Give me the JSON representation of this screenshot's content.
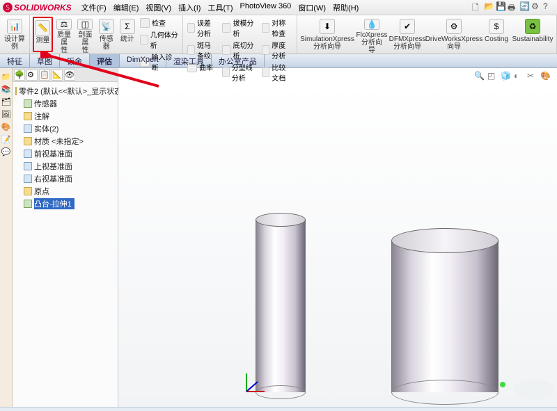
{
  "app": {
    "name": "SOLIDWORKS"
  },
  "menu": {
    "file": "文件(F)",
    "edit": "编辑(E)",
    "view": "视图(V)",
    "insert": "插入(I)",
    "tools": "工具(T)",
    "photoview": "PhotoView 360",
    "window": "窗口(W)",
    "help": "帮助(H)"
  },
  "ribbon": {
    "design_study": "设计算\n例",
    "measure": "测量",
    "mass_props": "质量属\n性",
    "section_props": "剖面属\n性",
    "sensor": "传感器",
    "statistics": "统计",
    "check": "检查",
    "geom_analysis": "几何体分析",
    "import_diag": "输入诊断",
    "deviation": "误差分析",
    "zebra": "斑马条纹",
    "curvature": "曲率",
    "draft": "拔模分析",
    "undercut": "底切分析",
    "parting_line": "分型线分析",
    "symmetry": "对称检查",
    "thickness": "厚度分析",
    "compare_docs": "比较文档",
    "sim_xpress": "SimulationXpress\n分析向导",
    "flo_xpress": "FloXpress\n分析向\n导",
    "dfm_xpress": "DFMXpress\n分析向导",
    "driveworks": "DriveWorksXpress\n向导",
    "costing": "Costing",
    "sustainability": "Sustainability"
  },
  "tabs": {
    "features": "特征",
    "sketch": "草图",
    "sheetmetal": "钣金",
    "evaluate": "评估",
    "dimxpert": "DimXpert",
    "render": "渲染工具",
    "office": "办公室产品"
  },
  "tree": {
    "root": "零件2 (默认<<默认>_显示状态",
    "sensor": "传感器",
    "annotations": "注解",
    "solid_bodies": "实体(2)",
    "material": "材质 <未指定>",
    "front_plane": "前视基准面",
    "top_plane": "上视基准面",
    "right_plane": "右视基准面",
    "origin": "原点",
    "extrude1": "凸台-拉伸1"
  }
}
